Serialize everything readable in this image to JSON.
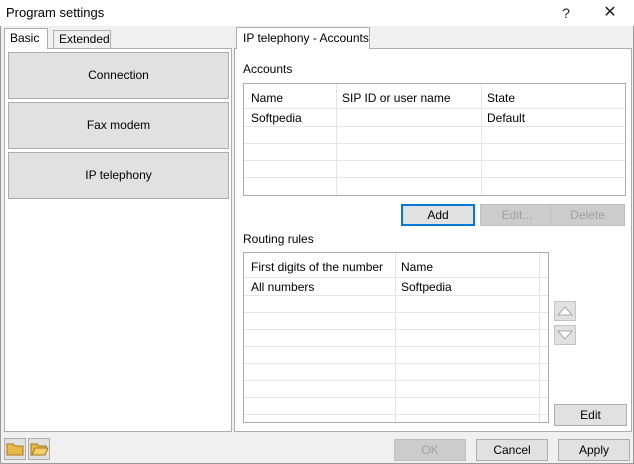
{
  "window": {
    "title": "Program settings",
    "help_glyph": "?",
    "close_glyph": "✕"
  },
  "left_tabs": [
    {
      "label": "Basic",
      "active": true
    },
    {
      "label": "Extended",
      "active": false
    }
  ],
  "categories": [
    {
      "label": "Connection"
    },
    {
      "label": "Fax modem"
    },
    {
      "label": "IP telephony"
    }
  ],
  "right_tab": {
    "label": "IP telephony - Accounts"
  },
  "accounts": {
    "title": "Accounts",
    "columns": [
      "Name",
      "SIP ID or user name",
      "State"
    ],
    "rows": [
      [
        "Softpedia",
        "",
        "Default"
      ]
    ],
    "buttons": {
      "add": "Add",
      "edit": "Edit...",
      "delete": "Delete"
    }
  },
  "routing": {
    "title": "Routing rules",
    "columns": [
      "First digits of the number",
      "Name"
    ],
    "rows": [
      [
        "All numbers",
        "Softpedia"
      ]
    ],
    "edit_button": "Edit"
  },
  "footer": {
    "ok": "OK",
    "cancel": "Cancel",
    "apply": "Apply"
  },
  "colors": {
    "window_bg": "#f0f0f0",
    "panel_bg": "#ffffff",
    "focus_border": "#0078d7",
    "folder_icon": "#e8b84a"
  }
}
